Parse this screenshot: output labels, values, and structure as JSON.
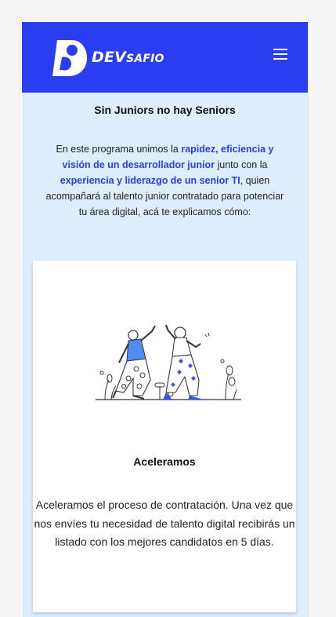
{
  "header": {
    "brand_main": "DEV",
    "brand_small": "SAFIO",
    "menu_icon": "hamburger-menu-icon",
    "background_color": "#2b3df0"
  },
  "hero": {
    "title": "Sin Juniors no hay Seniors",
    "intro": {
      "part1": "En este programa unimos la ",
      "highlight1": "rapidez, eficiencia y visión de un desarrollador junior",
      "part2": " junto con la ",
      "highlight2": "experiencia y liderazgo de un senior TI",
      "part3": ", quien acompañará al talento junior contratado para potenciar tu área digital, acá te explicamos cómo:"
    }
  },
  "card": {
    "illustration": "high-five-illustration",
    "title": "Aceleramos",
    "text": "Aceleramos el proceso de contratación. Una vez que nos envíes tu necesidad de talento digital recibirás un listado con los mejores candidatos en 5 días."
  },
  "colors": {
    "accent": "#2b3df0",
    "section_bg": "#ddeeff",
    "card_bg": "#ffffff"
  }
}
